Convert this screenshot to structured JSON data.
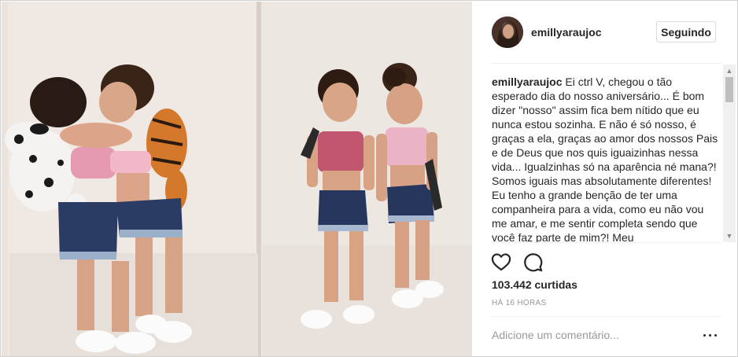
{
  "header": {
    "username": "emillyaraujoc",
    "follow_label": "Seguindo"
  },
  "post": {
    "caption_user": "emillyaraujoc",
    "caption_text": "Ei ctrl V, chegou o tão esperado dia do nosso aniversário... É bom dizer \"nosso\" assim fica bem nítido que eu nunca estou sozinha. E não é só nosso, é graças a ela, graças ao amor dos nossos Pais e de Deus que nos quis iguaizinhas nessa vida... Igualzinhas só na aparência né mana?! Somos iguais mas absolutamente diferentes! Eu tenho a grande benção de ter uma companheira para a vida, como eu não vou me amar, e me sentir completa sendo que você faz parte de mim?! Meu",
    "likes": "103.442 curtidas",
    "time": "HÁ 16 HORAS"
  },
  "comment": {
    "placeholder": "Adicione um comentário..."
  },
  "icons": {
    "like": "heart-icon",
    "comment": "comment-icon",
    "more": "more-options-icon"
  },
  "colors": {
    "text": "#262626",
    "muted": "#999999",
    "border": "#efefef",
    "button_border": "#dbdbdb"
  }
}
